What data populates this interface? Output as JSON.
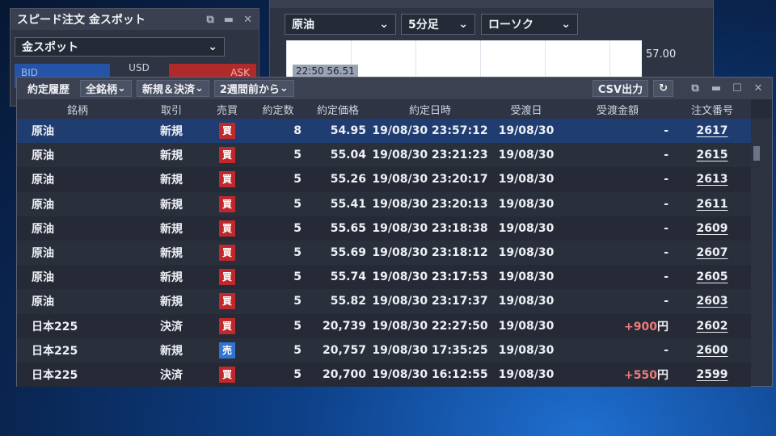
{
  "speed_window": {
    "title": "スピード注文 金スポット",
    "symbol": "金スポット",
    "bid_label": "BID",
    "currency": "USD",
    "ask_label": "ASK"
  },
  "chart_window": {
    "symbol": "原油",
    "interval": "5分足",
    "chart_type": "ローソク",
    "price_label": "57.00",
    "crosshair": "22:50 56.51"
  },
  "main": {
    "toolbar": {
      "title": "約定履歴",
      "filter_symbol": "全銘柄",
      "filter_type": "新規＆決済",
      "filter_period": "2週間前から",
      "csv": "CSV出力"
    },
    "columns": [
      "銘柄",
      "取引",
      "売買",
      "約定数",
      "約定価格",
      "約定日時",
      "受渡日",
      "受渡金額",
      "注文番号"
    ],
    "rows": [
      {
        "symbol": "原油",
        "type": "新規",
        "side": "買",
        "qty": "8",
        "price": "54.95",
        "datetime": "19/08/30 23:57:12",
        "settle": "19/08/30",
        "amount": "-",
        "amount_unit": "",
        "order": "2617"
      },
      {
        "symbol": "原油",
        "type": "新規",
        "side": "買",
        "qty": "5",
        "price": "55.04",
        "datetime": "19/08/30 23:21:23",
        "settle": "19/08/30",
        "amount": "-",
        "amount_unit": "",
        "order": "2615"
      },
      {
        "symbol": "原油",
        "type": "新規",
        "side": "買",
        "qty": "5",
        "price": "55.26",
        "datetime": "19/08/30 23:20:17",
        "settle": "19/08/30",
        "amount": "-",
        "amount_unit": "",
        "order": "2613"
      },
      {
        "symbol": "原油",
        "type": "新規",
        "side": "買",
        "qty": "5",
        "price": "55.41",
        "datetime": "19/08/30 23:20:13",
        "settle": "19/08/30",
        "amount": "-",
        "amount_unit": "",
        "order": "2611"
      },
      {
        "symbol": "原油",
        "type": "新規",
        "side": "買",
        "qty": "5",
        "price": "55.65",
        "datetime": "19/08/30 23:18:38",
        "settle": "19/08/30",
        "amount": "-",
        "amount_unit": "",
        "order": "2609"
      },
      {
        "symbol": "原油",
        "type": "新規",
        "side": "買",
        "qty": "5",
        "price": "55.69",
        "datetime": "19/08/30 23:18:12",
        "settle": "19/08/30",
        "amount": "-",
        "amount_unit": "",
        "order": "2607"
      },
      {
        "symbol": "原油",
        "type": "新規",
        "side": "買",
        "qty": "5",
        "price": "55.74",
        "datetime": "19/08/30 23:17:53",
        "settle": "19/08/30",
        "amount": "-",
        "amount_unit": "",
        "order": "2605"
      },
      {
        "symbol": "原油",
        "type": "新規",
        "side": "買",
        "qty": "5",
        "price": "55.82",
        "datetime": "19/08/30 23:17:37",
        "settle": "19/08/30",
        "amount": "-",
        "amount_unit": "",
        "order": "2603"
      },
      {
        "symbol": "日本225",
        "type": "決済",
        "side": "買",
        "qty": "5",
        "price": "20,739",
        "datetime": "19/08/30 22:27:50",
        "settle": "19/08/30",
        "amount": "+900",
        "amount_unit": "円",
        "order": "2602"
      },
      {
        "symbol": "日本225",
        "type": "新規",
        "side": "売",
        "qty": "5",
        "price": "20,757",
        "datetime": "19/08/30 17:35:25",
        "settle": "19/08/30",
        "amount": "-",
        "amount_unit": "",
        "order": "2600"
      },
      {
        "symbol": "日本225",
        "type": "決済",
        "side": "買",
        "qty": "5",
        "price": "20,700",
        "datetime": "19/08/30 16:12:55",
        "settle": "19/08/30",
        "amount": "+550",
        "amount_unit": "円",
        "order": "2599"
      }
    ]
  },
  "colors": {
    "buy": "#c0282b",
    "sell": "#2f74d0",
    "profit": "#f07a7a",
    "selected_row": "#1f3d70"
  }
}
